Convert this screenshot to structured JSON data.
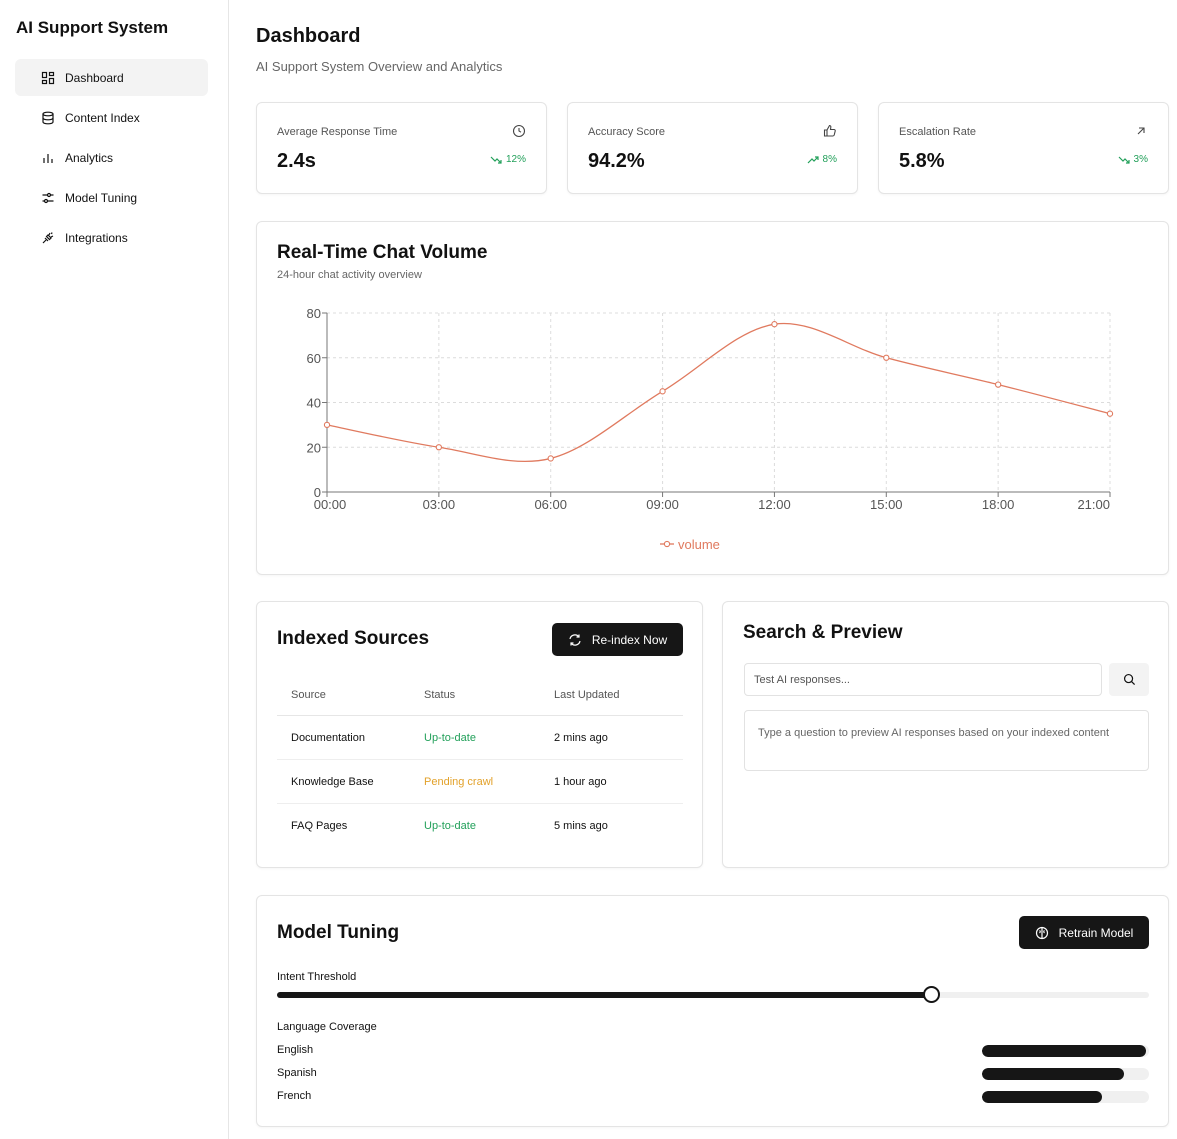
{
  "sidebar": {
    "brand": "AI Support System",
    "items": [
      {
        "label": "Dashboard",
        "icon": "dashboard-grid-icon"
      },
      {
        "label": "Content Index",
        "icon": "database-icon"
      },
      {
        "label": "Analytics",
        "icon": "bar-chart-icon"
      },
      {
        "label": "Model Tuning",
        "icon": "sliders-icon"
      },
      {
        "label": "Integrations",
        "icon": "plug-icon"
      }
    ],
    "active_index": 0
  },
  "header": {
    "title": "Dashboard",
    "subtitle": "AI Support System Overview and Analytics"
  },
  "metrics": [
    {
      "label": "Average Response Time",
      "value": "2.4s",
      "trend": "12%",
      "trend_dir": "down",
      "icon": "clock-icon"
    },
    {
      "label": "Accuracy Score",
      "value": "94.2%",
      "trend": "8%",
      "trend_dir": "up",
      "icon": "thumbs-up-icon"
    },
    {
      "label": "Escalation Rate",
      "value": "5.8%",
      "trend": "3%",
      "trend_dir": "down",
      "icon": "arrow-up-right-icon"
    }
  ],
  "chart_data": {
    "type": "line",
    "title": "Real-Time Chat Volume",
    "subtitle": "24-hour chat activity overview",
    "x": [
      "00:00",
      "03:00",
      "06:00",
      "09:00",
      "12:00",
      "15:00",
      "18:00",
      "21:00"
    ],
    "series": [
      {
        "name": "volume",
        "values": [
          30,
          20,
          15,
          45,
          75,
          60,
          48,
          35
        ],
        "color": "#e07a5f"
      }
    ],
    "ylim": [
      0,
      80
    ],
    "yticks": [
      0,
      20,
      40,
      60,
      80
    ],
    "grid": true,
    "legend": "bottom-center"
  },
  "sources": {
    "title": "Indexed Sources",
    "reindex_label": "Re-index Now",
    "columns": [
      "Source",
      "Status",
      "Last Updated"
    ],
    "rows": [
      {
        "source": "Documentation",
        "status": "Up-to-date",
        "status_kind": "ok",
        "updated": "2 mins ago"
      },
      {
        "source": "Knowledge Base",
        "status": "Pending crawl",
        "status_kind": "pending",
        "updated": "1 hour ago"
      },
      {
        "source": "FAQ Pages",
        "status": "Up-to-date",
        "status_kind": "ok",
        "updated": "5 mins ago"
      }
    ]
  },
  "search": {
    "title": "Search & Preview",
    "placeholder": "Test AI responses...",
    "value": "",
    "preview_text": "Type a question to preview AI responses based on your indexed content"
  },
  "tuning": {
    "title": "Model Tuning",
    "retrain_label": "Retrain Model",
    "threshold_label": "Intent Threshold",
    "threshold_value": 0.75,
    "coverage_label": "Language Coverage",
    "languages": [
      {
        "name": "English",
        "coverage": 0.98
      },
      {
        "name": "Spanish",
        "coverage": 0.85
      },
      {
        "name": "French",
        "coverage": 0.72
      }
    ]
  },
  "colors": {
    "accent_dark": "#161616",
    "trend_green": "#22a05a",
    "pending_amber": "#e2a12a",
    "chart_line": "#e07a5f"
  }
}
